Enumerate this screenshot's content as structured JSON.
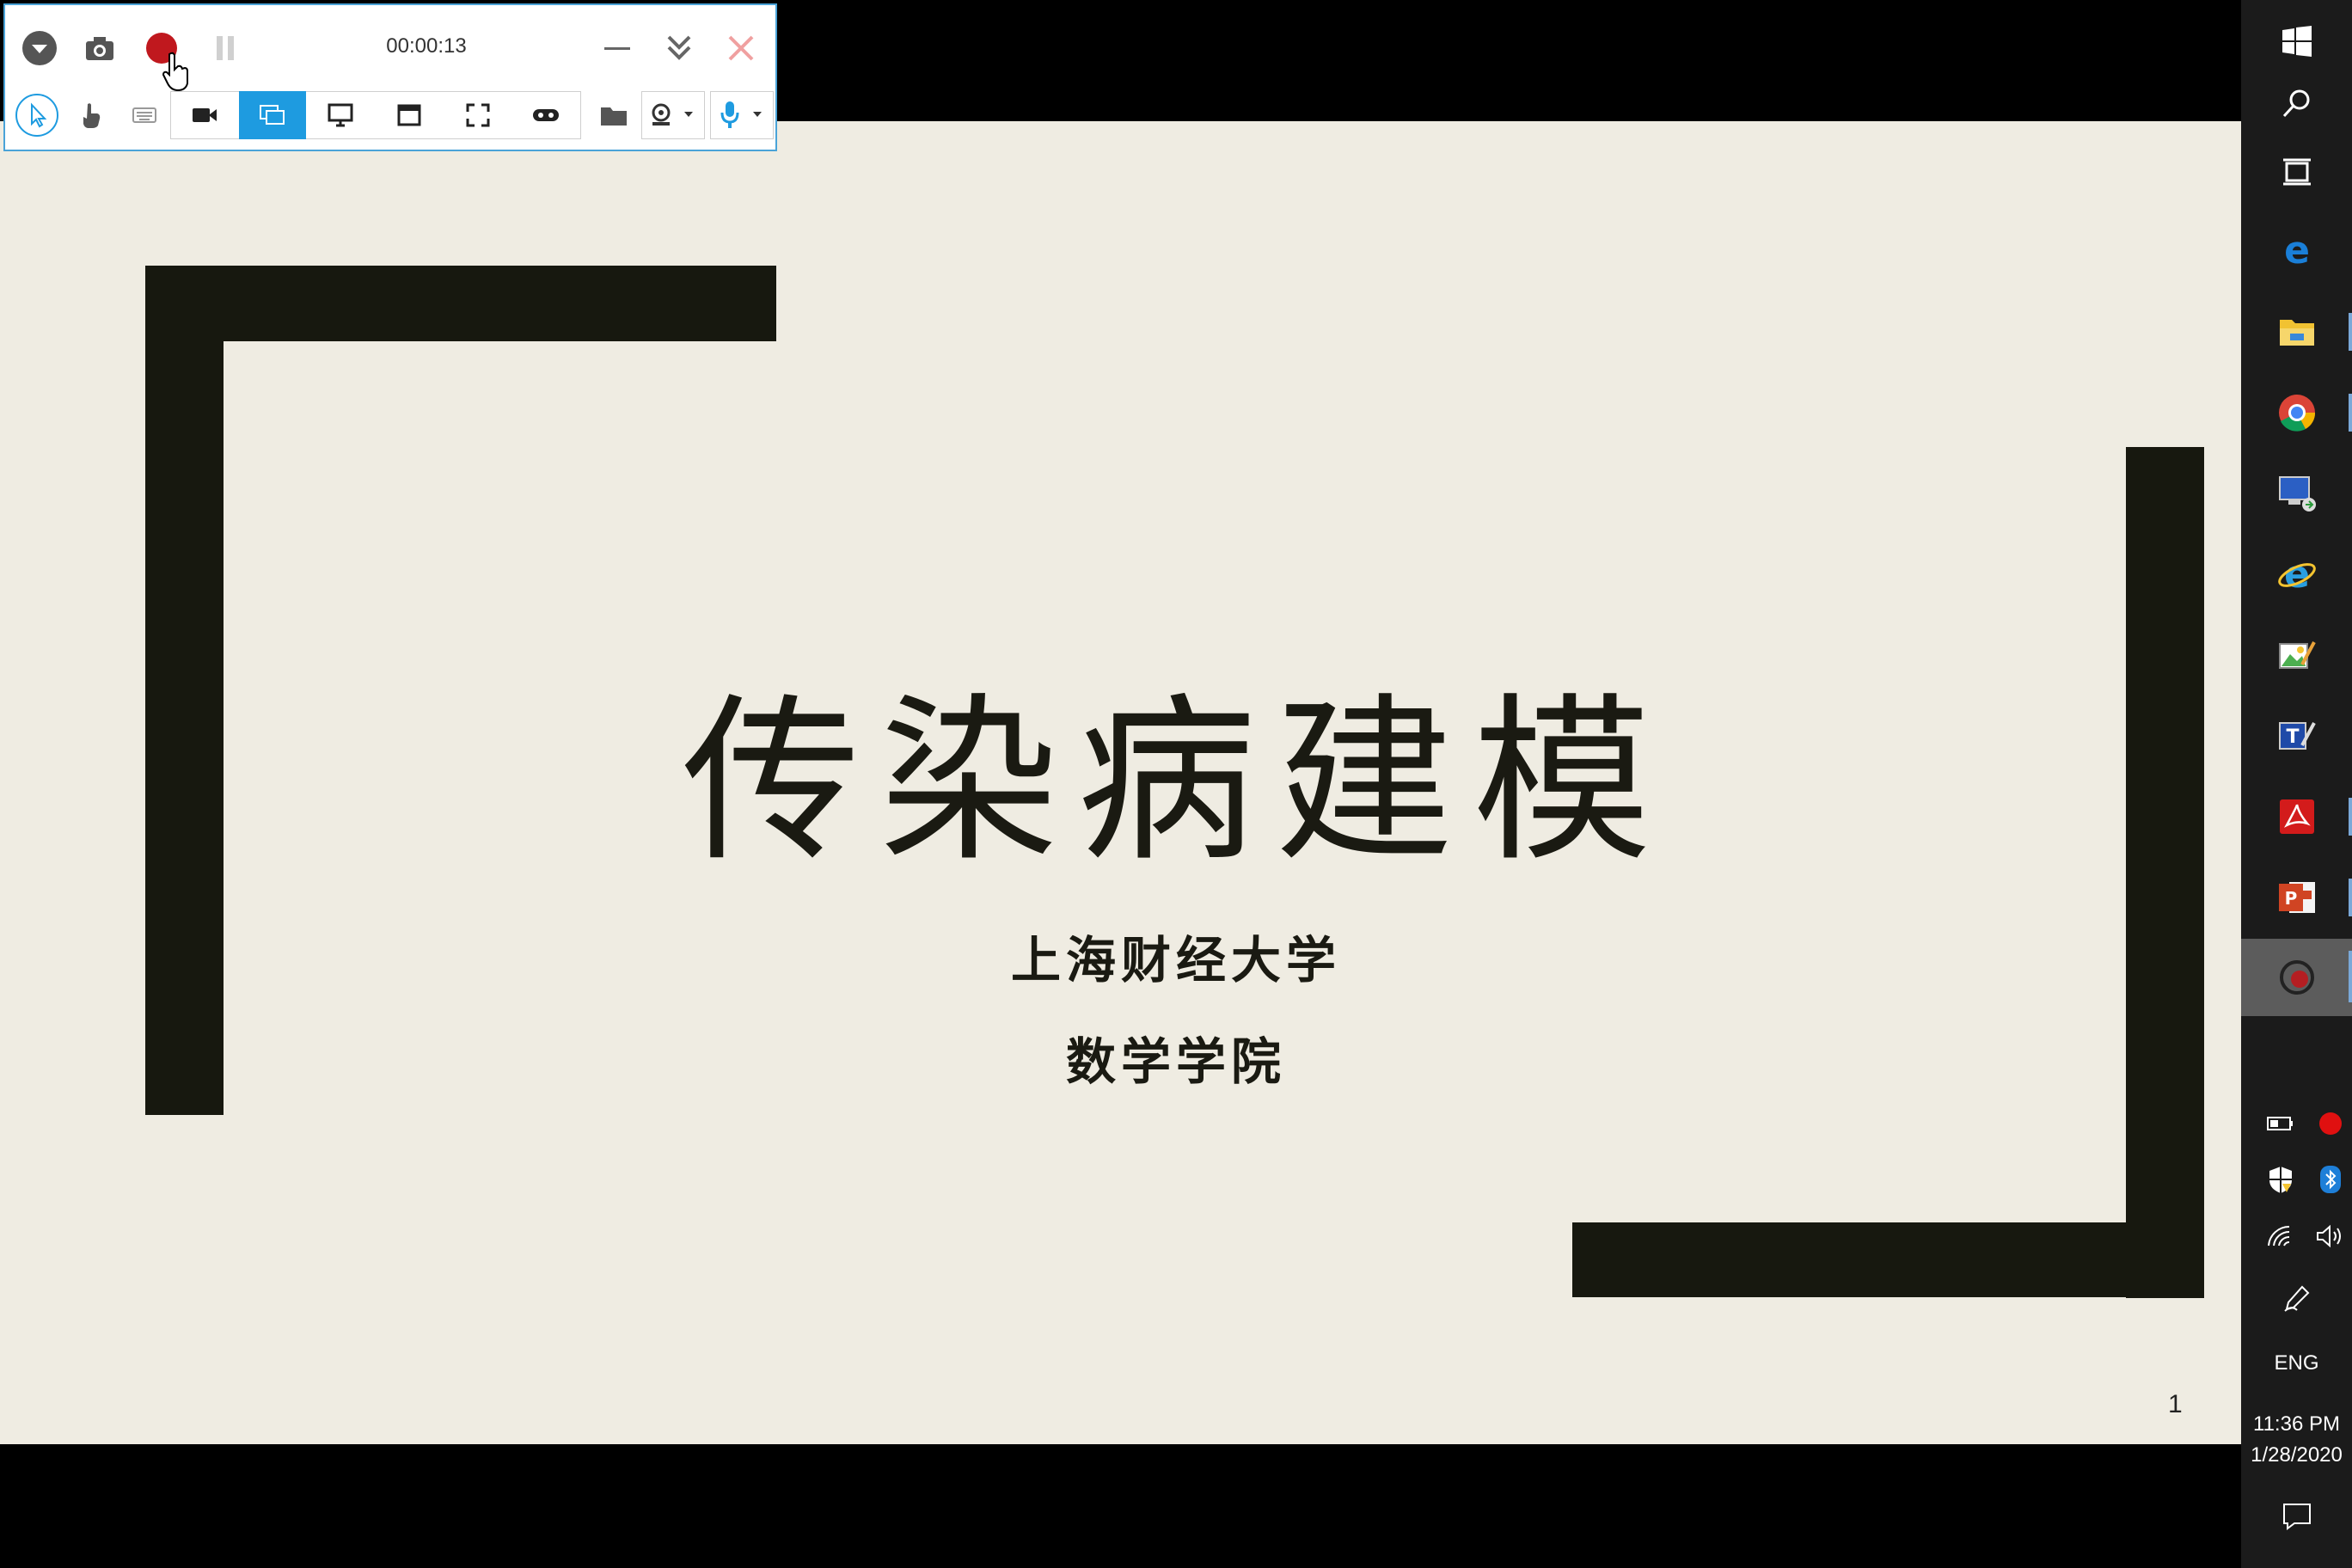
{
  "recorder": {
    "timer": "00:00:13",
    "accent": "#1e9be0",
    "record_color": "#c0181e",
    "icons": [
      "dropdown-icon",
      "camera-icon",
      "record-icon",
      "pause-icon",
      "minimize-icon",
      "collapse-icon",
      "close-icon",
      "cursor-icon",
      "hand-icon",
      "keyboard-icon",
      "video-icon",
      "screen-region-icon",
      "monitor-icon",
      "window-icon",
      "fullscreen-icon",
      "game-icon",
      "folder-icon",
      "webcam-icon",
      "microphone-icon"
    ]
  },
  "slide": {
    "title": "传染病建模",
    "subtitle_1": "上海财经大学",
    "subtitle_2": "数学学院",
    "slide_number": "1",
    "background": "#efece2",
    "bar_color": "#17180f"
  },
  "taskbar": {
    "language": "ENG",
    "time": "11:36 PM",
    "date": "1/28/2020",
    "apps": [
      "windows-start-icon",
      "search-icon",
      "task-view-icon",
      "edge-icon",
      "file-explorer-icon",
      "chrome-icon",
      "remote-desktop-icon",
      "internet-explorer-icon",
      "image-editor-icon",
      "teamviewer-icon",
      "acrobat-icon",
      "powerpoint-icon",
      "screen-recorder-icon"
    ]
  }
}
